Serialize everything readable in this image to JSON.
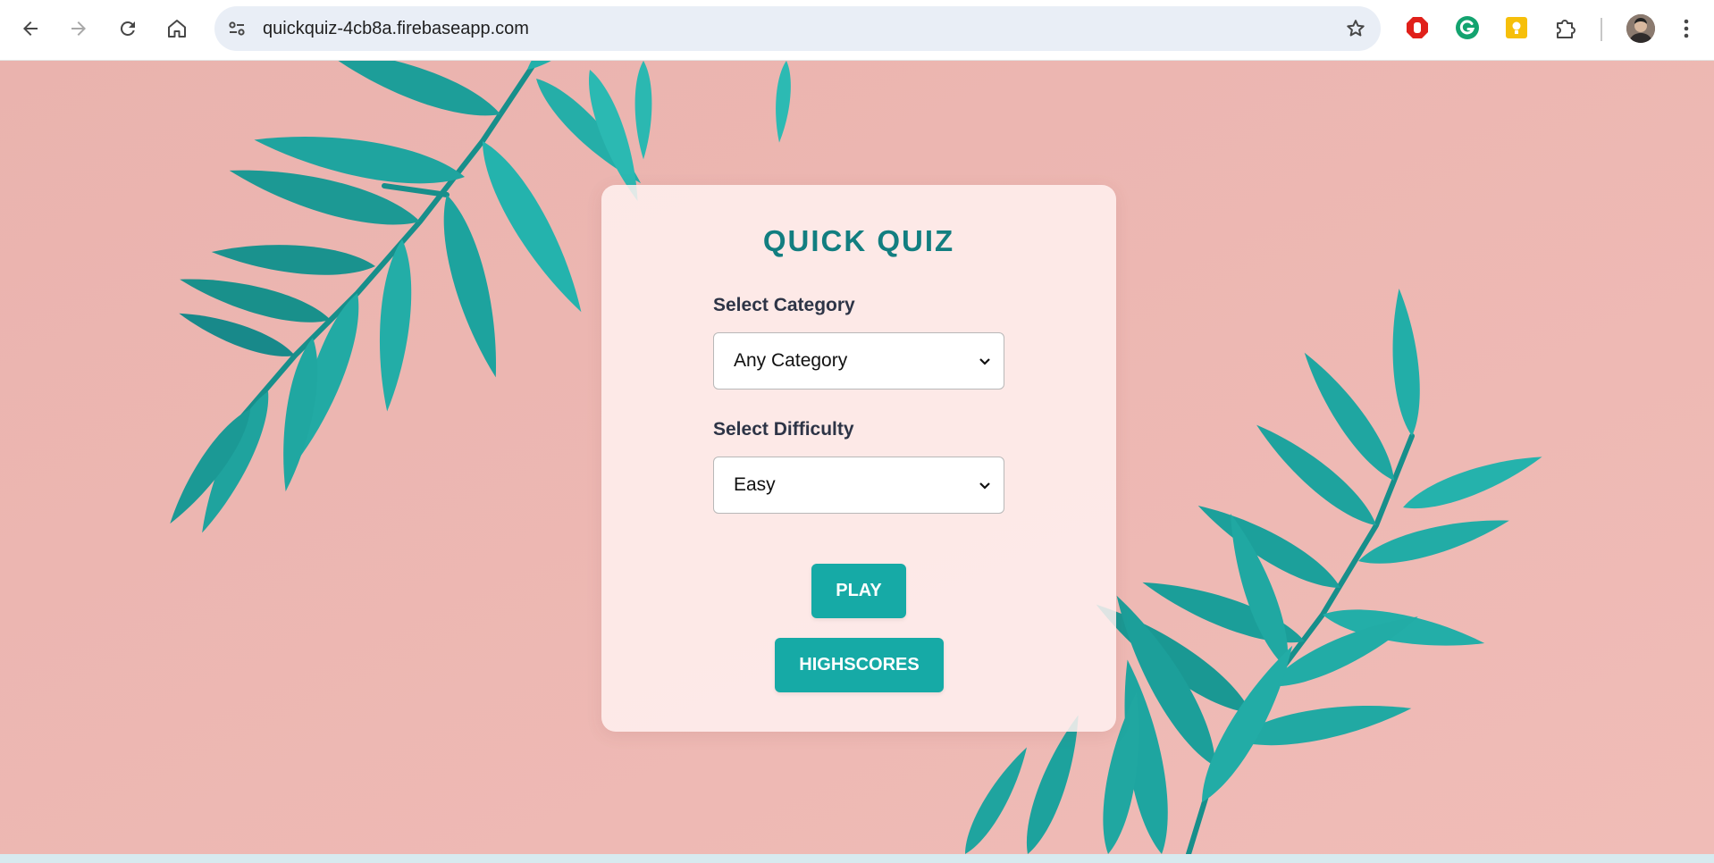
{
  "browser": {
    "url": "quickquiz-4cb8a.firebaseapp.com",
    "toolbar_icons": [
      "back-arrow-icon",
      "forward-arrow-icon",
      "reload-icon",
      "home-icon",
      "site-info-icon",
      "star-icon"
    ],
    "extensions": [
      "adblock-icon",
      "grammarly-icon",
      "keep-notes-icon",
      "puzzle-icon"
    ],
    "colors": {
      "omnibox": "#e9eef6"
    }
  },
  "quiz": {
    "title": "QUICK QUIZ",
    "category_label": "Select Category",
    "category_value": "Any Category",
    "difficulty_label": "Select Difficulty",
    "difficulty_value": "Easy",
    "play_button": "PLAY",
    "highscores_button": "HIGHSCORES"
  },
  "theme": {
    "background": "#efb8b3",
    "accent": "#16aaa6",
    "title_color": "#127e80",
    "leaf_color": "#1fa9a4"
  }
}
